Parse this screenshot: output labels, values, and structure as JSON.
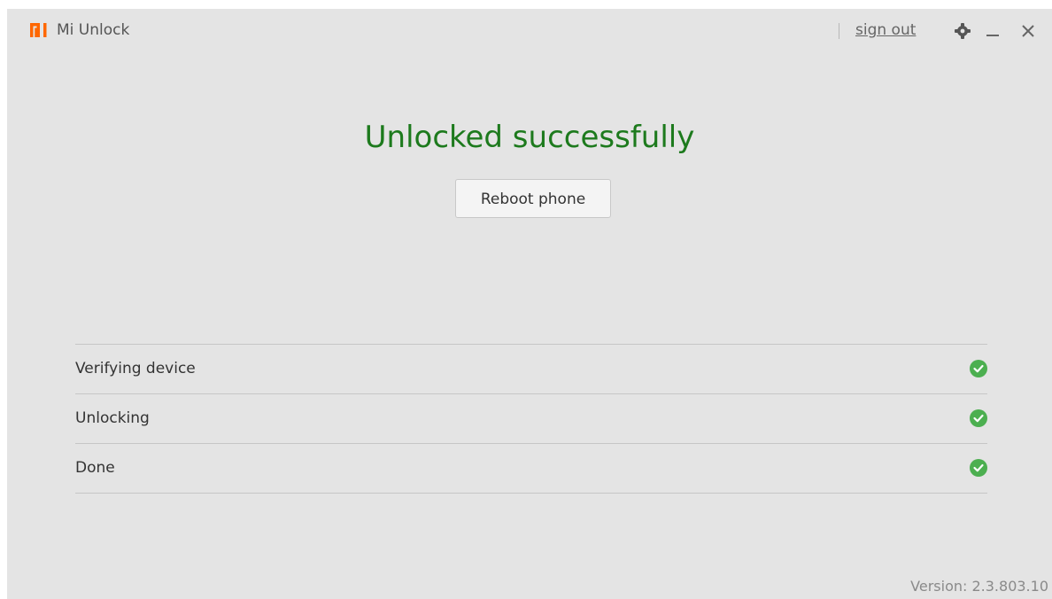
{
  "header": {
    "app_title": "Mi Unlock",
    "sign_out_label": "sign out",
    "icons": [
      "mi-logo-icon",
      "gear-icon",
      "minimize-icon",
      "close-icon"
    ]
  },
  "main": {
    "headline": "Unlocked successfully",
    "reboot_label": "Reboot phone"
  },
  "steps": [
    {
      "label": "Verifying device",
      "status": "done",
      "icon": "check-circle-icon"
    },
    {
      "label": "Unlocking",
      "status": "done",
      "icon": "check-circle-icon"
    },
    {
      "label": "Done",
      "status": "done",
      "icon": "check-circle-icon"
    }
  ],
  "footer": {
    "version": "Version: 2.3.803.10"
  },
  "colors": {
    "brand": "#ff6700",
    "success_text": "#1d7a1d",
    "check": "#4caf50",
    "background": "#e4e4e4"
  }
}
